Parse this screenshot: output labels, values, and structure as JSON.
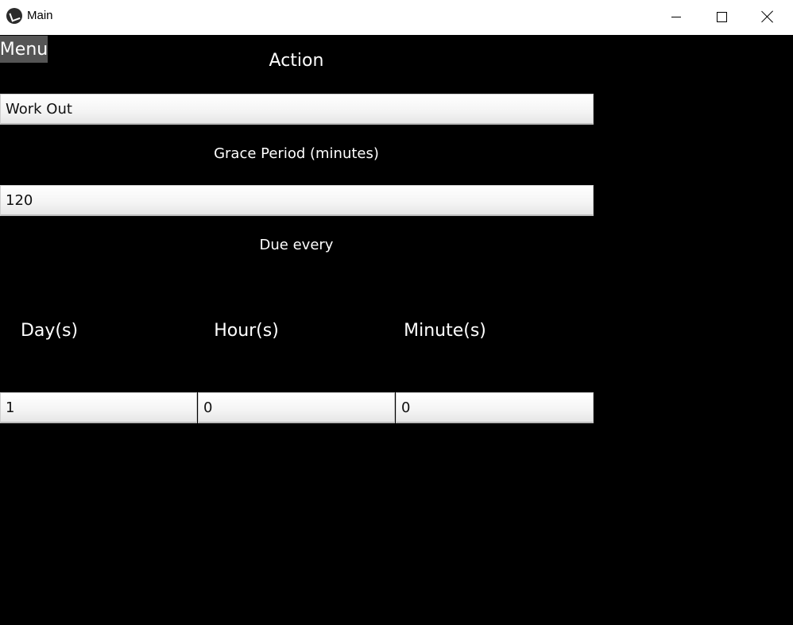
{
  "window": {
    "title": "Main",
    "icon": "kivy-app-icon",
    "controls": [
      "minimize-icon",
      "maximize-icon",
      "close-icon"
    ]
  },
  "menu": {
    "label": "Menu"
  },
  "form": {
    "action_label": "Action",
    "action_value": "Work Out",
    "grace_label": "Grace Period (minutes)",
    "grace_value": "120",
    "due_label": "Due every",
    "days_label": "Day(s)",
    "hours_label": "Hour(s)",
    "minutes_label": "Minute(s)",
    "days_value": "1",
    "hours_value": "0",
    "minutes_value": "0"
  },
  "colors": {
    "background": "#000000",
    "menu_button": "#555555",
    "text": "#ffffff"
  }
}
